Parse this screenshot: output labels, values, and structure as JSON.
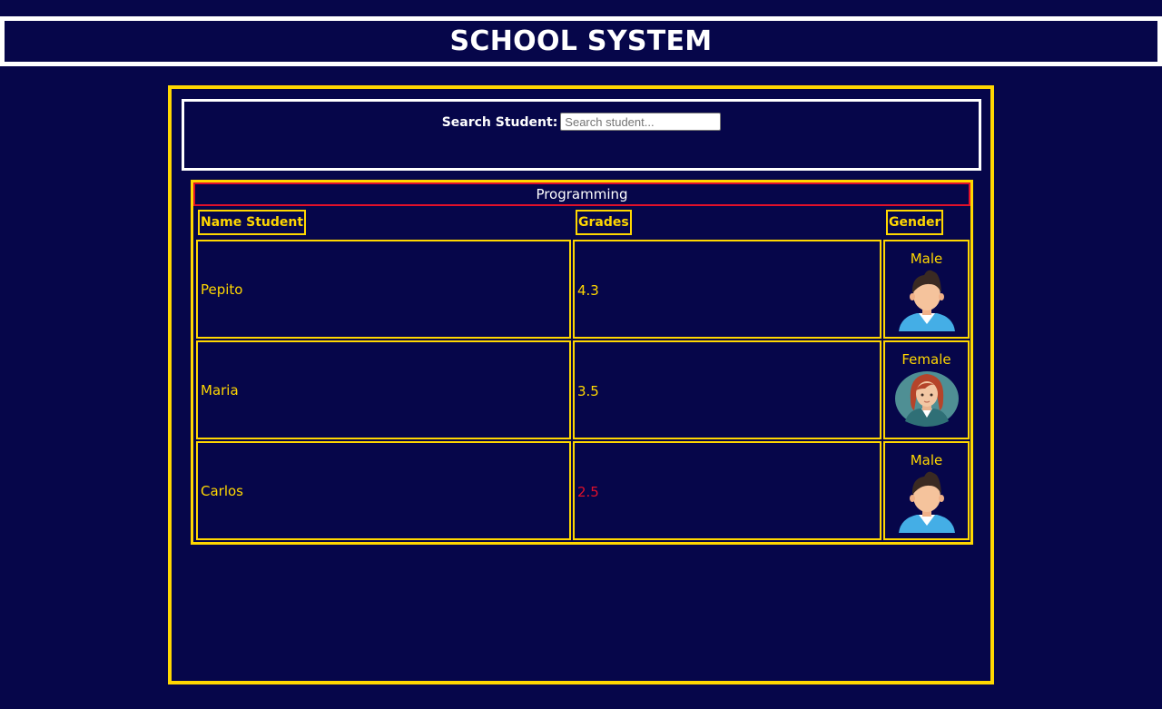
{
  "header": {
    "title": "SCHOOL SYSTEM"
  },
  "search": {
    "label": "Search Student:",
    "placeholder": "Search student...",
    "value": ""
  },
  "table": {
    "caption": "Programming",
    "columns": [
      "Name Student",
      "Grades",
      "Gender"
    ],
    "rows": [
      {
        "name": "Pepito",
        "grade": "4.3",
        "gender": "Male",
        "avatar": "male-avatar-icon",
        "grade_status": "pass"
      },
      {
        "name": "Maria",
        "grade": "3.5",
        "gender": "Female",
        "avatar": "female-avatar-icon",
        "grade_status": "pass"
      },
      {
        "name": "Carlos",
        "grade": "2.5",
        "gender": "Male",
        "avatar": "male-avatar-icon",
        "grade_status": "fail"
      }
    ]
  },
  "colors": {
    "background": "#06064a",
    "accent": "#ffd700",
    "caption_border": "#e0102a",
    "failing_grade": "#e0102a",
    "title_border": "#ffffff"
  }
}
